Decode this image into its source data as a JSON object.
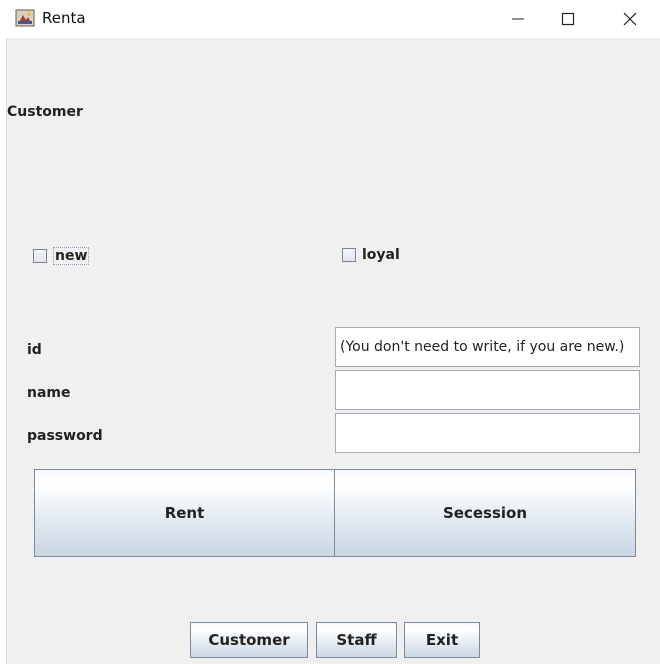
{
  "window": {
    "title": "Renta",
    "minimize_icon": "minimize-icon",
    "maximize_icon": "maximize-icon",
    "close_icon": "close-icon"
  },
  "panel": {
    "heading": "Customer"
  },
  "checkboxes": {
    "new_label": "new",
    "new_checked": false,
    "loyal_label": "loyal",
    "loyal_checked": false
  },
  "form": {
    "id_label": "id",
    "id_value": "(You don't need to write, if you are new.)",
    "name_label": "name",
    "name_value": "",
    "password_label": "password",
    "password_value": ""
  },
  "actions": {
    "rent_label": "Rent",
    "secession_label": "Secession"
  },
  "bottom_nav": {
    "customer_label": "Customer",
    "staff_label": "Staff",
    "exit_label": "Exit"
  }
}
